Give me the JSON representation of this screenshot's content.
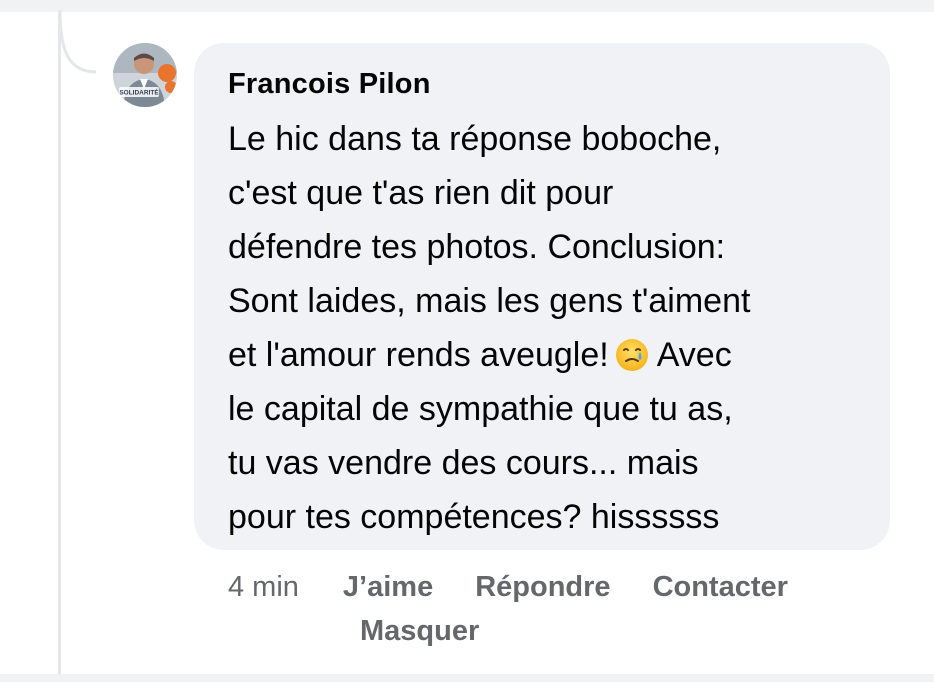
{
  "comment": {
    "author": "Francois Pilon",
    "avatar_icon": "profile-photo-avatar",
    "avatar_badge": "SOLIDARITÉ",
    "body_lines": [
      "Le hic dans ta réponse boboche,",
      "c'est que t'as rien dit pour",
      "défendre tes photos. Conclusion:",
      "Sont laides, mais les gens t'aiment",
      "et l'amour rends aveugle!",
      "Avec",
      "le capital de sympathie que tu as,",
      "tu vas vendre des cours... mais",
      "pour tes compétences? hissssss"
    ],
    "emoji": "crying-smile-emoji"
  },
  "actions": {
    "timestamp": "4 min",
    "like": "J’aime",
    "reply": "Répondre",
    "contact": "Contacter",
    "hide": "Masquer"
  },
  "colors": {
    "bubble": "#f0f2f5",
    "text": "#050505",
    "meta": "#65676b",
    "thread_line": "#e4e6ea"
  }
}
